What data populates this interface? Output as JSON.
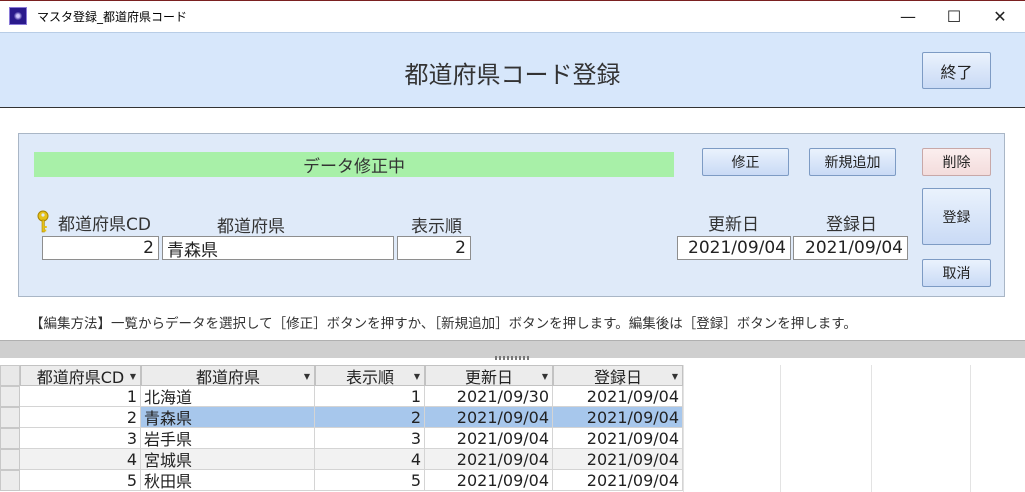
{
  "window": {
    "title": "マスタ登録_都道府県コード"
  },
  "header": {
    "title": "都道府県コード登録",
    "close_label": "終了"
  },
  "form": {
    "status": "データ修正中",
    "buttons": {
      "edit": "修正",
      "add": "新規追加",
      "delete": "削除",
      "register": "登録",
      "cancel": "取消"
    },
    "labels": {
      "cd": "都道府県CD",
      "name": "都道府県",
      "order": "表示順",
      "updated": "更新日",
      "created": "登録日"
    },
    "values": {
      "cd": "2",
      "name": "青森県",
      "order": "2",
      "updated": "2021/09/04",
      "created": "2021/09/04"
    },
    "instruction": "【編集方法】一覧からデータを選択して［修正］ボタンを押すか、［新規追加］ボタンを押します。編集後は［登録］ボタンを押します。"
  },
  "grid": {
    "columns": [
      "都道府県CD",
      "都道府県",
      "表示順",
      "更新日",
      "登録日"
    ],
    "rows": [
      {
        "cd": "1",
        "name": "北海道",
        "order": "1",
        "updated": "2021/09/30",
        "created": "2021/09/04"
      },
      {
        "cd": "2",
        "name": "青森県",
        "order": "2",
        "updated": "2021/09/04",
        "created": "2021/09/04"
      },
      {
        "cd": "3",
        "name": "岩手県",
        "order": "3",
        "updated": "2021/09/04",
        "created": "2021/09/04"
      },
      {
        "cd": "4",
        "name": "宮城県",
        "order": "4",
        "updated": "2021/09/04",
        "created": "2021/09/04"
      },
      {
        "cd": "5",
        "name": "秋田県",
        "order": "5",
        "updated": "2021/09/04",
        "created": "2021/09/04"
      }
    ],
    "selected_row": 1
  },
  "colors": {
    "header_bg": "#d7e7fb",
    "panel_bg": "#dfeaf9",
    "status_bg": "#a8f0a8",
    "selected_row": "#a7c7ec"
  }
}
